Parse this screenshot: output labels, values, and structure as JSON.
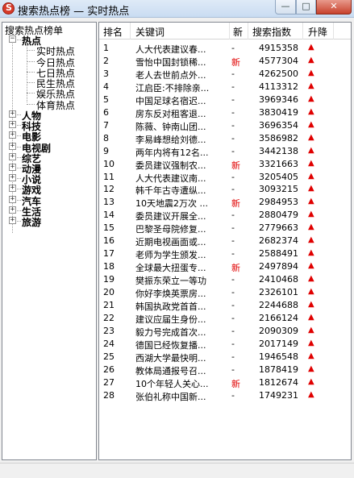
{
  "window": {
    "title": "搜索热点榜 — 实时热点",
    "min_label": "—",
    "max_label": "□",
    "close_label": "✕"
  },
  "tree": {
    "root": "搜索热点榜单",
    "categories": [
      {
        "label": "热点",
        "expanded": true,
        "children": [
          "实时热点",
          "今日热点",
          "七日热点",
          "民生热点",
          "娱乐热点",
          "体育热点"
        ]
      },
      {
        "label": "人物",
        "expanded": false
      },
      {
        "label": "科技",
        "expanded": false
      },
      {
        "label": "电影",
        "expanded": false
      },
      {
        "label": "电视剧",
        "expanded": false
      },
      {
        "label": "综艺",
        "expanded": false
      },
      {
        "label": "动漫",
        "expanded": false
      },
      {
        "label": "小说",
        "expanded": false
      },
      {
        "label": "游戏",
        "expanded": false
      },
      {
        "label": "汽车",
        "expanded": false
      },
      {
        "label": "生活",
        "expanded": false
      },
      {
        "label": "旅游",
        "expanded": false
      }
    ]
  },
  "table": {
    "headers": {
      "rank": "排名",
      "keyword": "关键词",
      "new": "新",
      "index": "搜索指数",
      "trend": "升降"
    },
    "rows": [
      {
        "rank": "1",
        "keyword": "人大代表建议春...",
        "new": "-",
        "index": "4915358",
        "trend": "▲"
      },
      {
        "rank": "2",
        "keyword": "雪怡中国封锁稀...",
        "new": "新",
        "index": "4577304",
        "trend": "▲"
      },
      {
        "rank": "3",
        "keyword": "老人去世前点外...",
        "new": "-",
        "index": "4262500",
        "trend": "▲"
      },
      {
        "rank": "4",
        "keyword": "江启臣:不排除亲...",
        "new": "-",
        "index": "4113312",
        "trend": "▲"
      },
      {
        "rank": "5",
        "keyword": "中国足球名宿迟...",
        "new": "-",
        "index": "3969346",
        "trend": "▲"
      },
      {
        "rank": "6",
        "keyword": "房东反对租客退...",
        "new": "-",
        "index": "3830419",
        "trend": "▲"
      },
      {
        "rank": "7",
        "keyword": "陈薇、钟南山团...",
        "new": "-",
        "index": "3696354",
        "trend": "▲"
      },
      {
        "rank": "8",
        "keyword": "李易峰想给刘德...",
        "new": "-",
        "index": "3586982",
        "trend": "▲"
      },
      {
        "rank": "9",
        "keyword": "两年内将有12名...",
        "new": "-",
        "index": "3442138",
        "trend": "▲"
      },
      {
        "rank": "10",
        "keyword": "委员建议强制农...",
        "new": "新",
        "index": "3321663",
        "trend": "▲"
      },
      {
        "rank": "11",
        "keyword": "人大代表建议南...",
        "new": "-",
        "index": "3205405",
        "trend": "▲"
      },
      {
        "rank": "12",
        "keyword": "韩千年古寺遭纵...",
        "new": "-",
        "index": "3093215",
        "trend": "▲"
      },
      {
        "rank": "13",
        "keyword": "10天地震2万次 ...",
        "new": "新",
        "index": "2984953",
        "trend": "▲"
      },
      {
        "rank": "14",
        "keyword": "委员建议开展全...",
        "new": "-",
        "index": "2880479",
        "trend": "▲"
      },
      {
        "rank": "15",
        "keyword": "巴黎圣母院修复...",
        "new": "-",
        "index": "2779663",
        "trend": "▲"
      },
      {
        "rank": "16",
        "keyword": "近期电视画面或...",
        "new": "-",
        "index": "2682374",
        "trend": "▲"
      },
      {
        "rank": "17",
        "keyword": "老师为学生颁发...",
        "new": "-",
        "index": "2588491",
        "trend": "▲"
      },
      {
        "rank": "18",
        "keyword": "全球最大扭蛋专...",
        "new": "新",
        "index": "2497894",
        "trend": "▲"
      },
      {
        "rank": "19",
        "keyword": "樊振东荣立一等功",
        "new": "-",
        "index": "2410468",
        "trend": "▲"
      },
      {
        "rank": "20",
        "keyword": "你好李焕英票房...",
        "new": "-",
        "index": "2326101",
        "trend": "▲"
      },
      {
        "rank": "21",
        "keyword": "韩国执政党首首...",
        "new": "-",
        "index": "2244688",
        "trend": "▲"
      },
      {
        "rank": "22",
        "keyword": "建议应届生身份...",
        "new": "-",
        "index": "2166124",
        "trend": "▲"
      },
      {
        "rank": "23",
        "keyword": "毅力号完成首次...",
        "new": "-",
        "index": "2090309",
        "trend": "▲"
      },
      {
        "rank": "24",
        "keyword": "德国已经恢复播...",
        "new": "-",
        "index": "2017149",
        "trend": "▲"
      },
      {
        "rank": "25",
        "keyword": "西湖大学最快明...",
        "new": "-",
        "index": "1946548",
        "trend": "▲"
      },
      {
        "rank": "26",
        "keyword": "教体局通报号召...",
        "new": "-",
        "index": "1878419",
        "trend": "▲"
      },
      {
        "rank": "27",
        "keyword": "10个年轻人关心...",
        "new": "新",
        "index": "1812674",
        "trend": "▲"
      },
      {
        "rank": "28",
        "keyword": "张伯礼称中国新...",
        "new": "-",
        "index": "1749231",
        "trend": "▲"
      }
    ]
  },
  "colors": {
    "new_marker": "#e00000",
    "trend_up": "#e00000"
  }
}
